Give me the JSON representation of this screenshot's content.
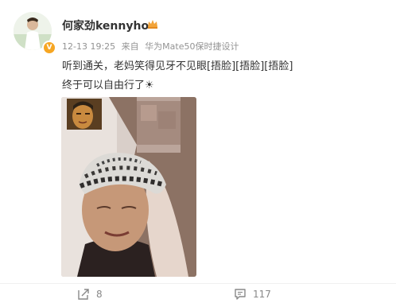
{
  "post": {
    "username": "何家劲kennyho",
    "timestamp": "12-13 19:25",
    "source_prefix": "来自",
    "device": "华为Mate50保时捷设计",
    "text_line1": "听到通关，老妈笑得见牙不见眼[捂脸][捂脸][捂脸]",
    "text_line2": "终于可以自由行了☀"
  },
  "actions": {
    "share_count": "8",
    "comment_count": "117"
  },
  "icons": {
    "avatar": "avatar",
    "verified": "verified-badge-icon",
    "crown": "crown-icon",
    "share": "share-icon",
    "comment": "comment-icon"
  },
  "colors": {
    "verified": "#f6a623",
    "meta_text": "#939393",
    "body_text": "#333333"
  }
}
